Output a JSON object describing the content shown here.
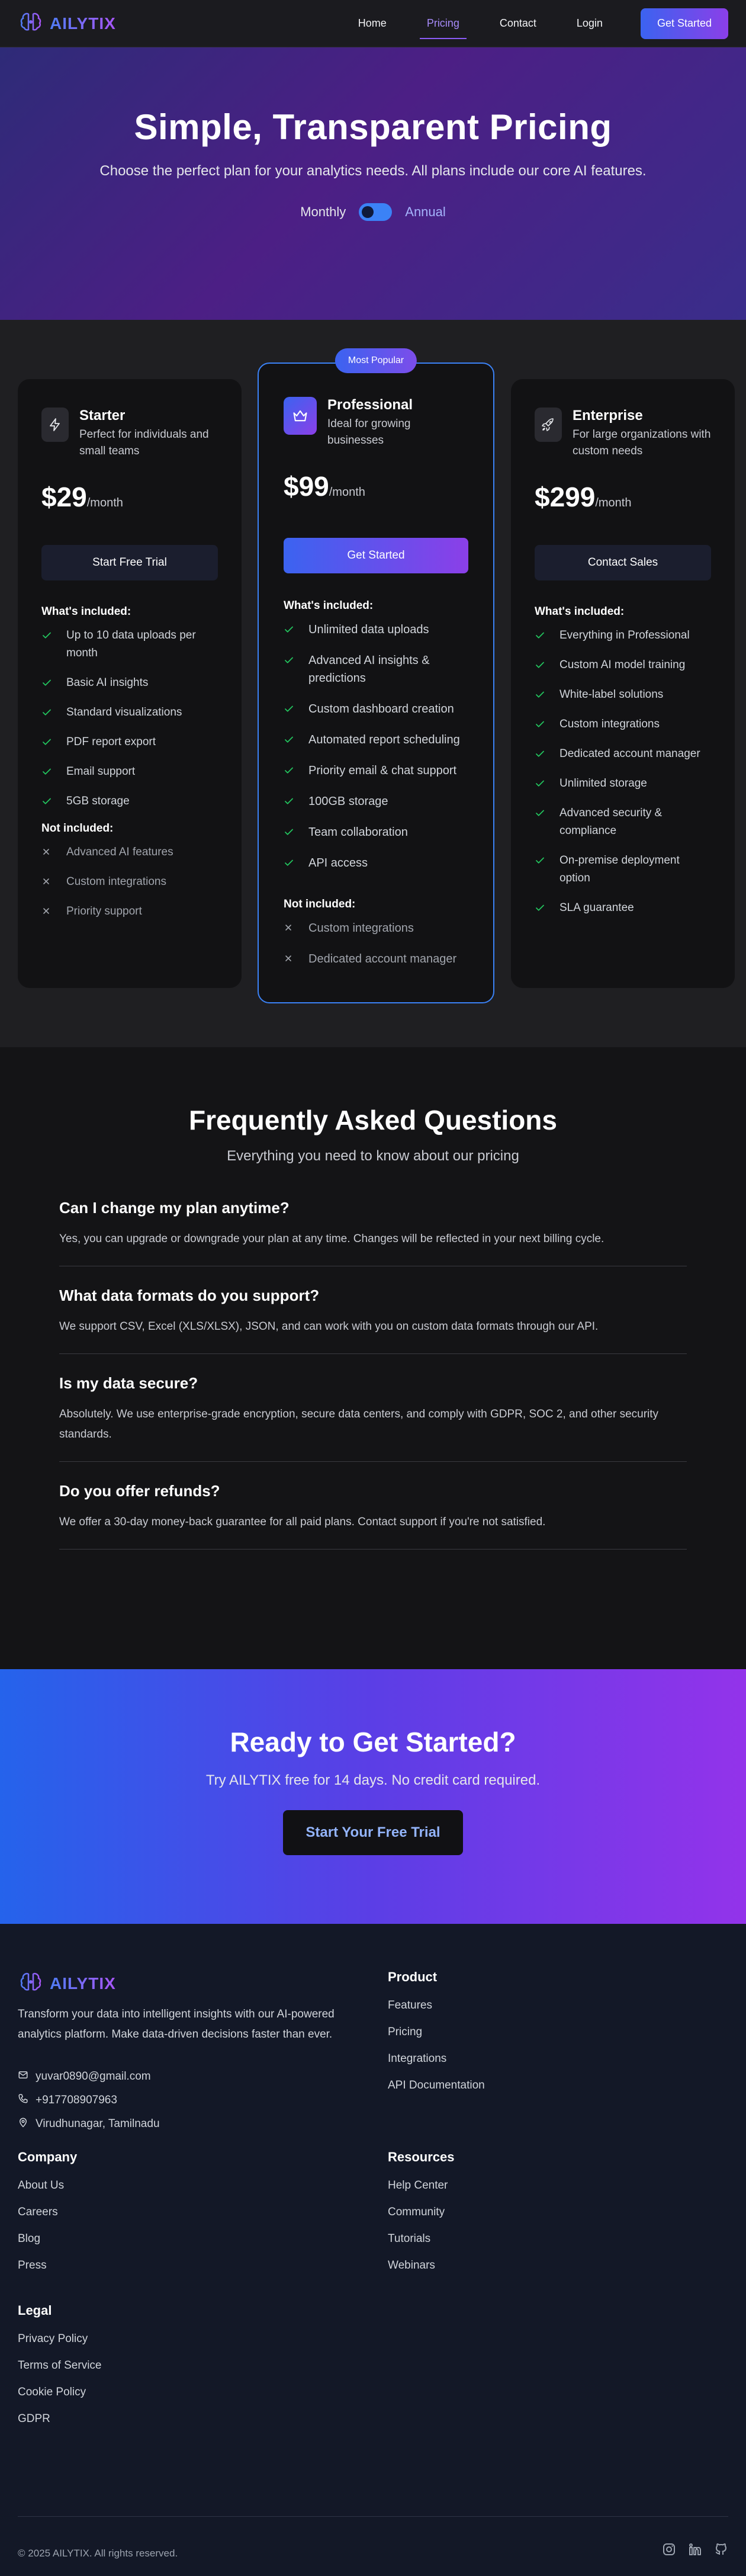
{
  "brand": {
    "name": "AILYTIX"
  },
  "nav": {
    "items": [
      {
        "label": "Home"
      },
      {
        "label": "Pricing"
      },
      {
        "label": "Contact"
      },
      {
        "label": "Login"
      }
    ],
    "active": "Pricing",
    "cta": "Get Started"
  },
  "hero": {
    "title": "Simple, Transparent Pricing",
    "subtitle": "Choose the perfect plan for your analytics needs. All plans include our core AI features.",
    "toggle_monthly": "Monthly",
    "toggle_annual": "Annual"
  },
  "plans": {
    "starter": {
      "name": "Starter",
      "description": "Perfect for individuals and small teams",
      "price": "$29",
      "period": "/month",
      "cta": "Start Free Trial",
      "included_title": "What's included:",
      "included": [
        "Up to 10 data uploads per month",
        "Basic AI insights",
        "Standard visualizations",
        "PDF report export",
        "Email support",
        "5GB storage"
      ],
      "not_included_title": "Not included:",
      "not_included": [
        "Advanced AI features",
        "Custom integrations",
        "Priority support"
      ]
    },
    "professional": {
      "badge": "Most Popular",
      "name": "Professional",
      "description": "Ideal for growing businesses",
      "price": "$99",
      "period": "/month",
      "cta": "Get Started",
      "included_title": "What's included:",
      "included": [
        "Unlimited data uploads",
        "Advanced AI insights & predictions",
        "Custom dashboard creation",
        "Automated report scheduling",
        "Priority email & chat support",
        "100GB storage",
        "Team collaboration",
        "API access"
      ],
      "not_included_title": "Not included:",
      "not_included": [
        "Custom integrations",
        "Dedicated account manager"
      ]
    },
    "enterprise": {
      "name": "Enterprise",
      "description": "For large organizations with custom needs",
      "price": "$299",
      "period": "/month",
      "cta": "Contact Sales",
      "included_title": "What's included:",
      "included": [
        "Everything in Professional",
        "Custom AI model training",
        "White-label solutions",
        "Custom integrations",
        "Dedicated account manager",
        "Unlimited storage",
        "Advanced security & compliance",
        "On-premise deployment option",
        "SLA guarantee"
      ]
    }
  },
  "faq": {
    "title": "Frequently Asked Questions",
    "subtitle": "Everything you need to know about our pricing",
    "items": [
      {
        "q": "Can I change my plan anytime?",
        "a": "Yes, you can upgrade or downgrade your plan at any time. Changes will be reflected in your next billing cycle."
      },
      {
        "q": "What data formats do you support?",
        "a": "We support CSV, Excel (XLS/XLSX), JSON, and can work with you on custom data formats through our API."
      },
      {
        "q": "Is my data secure?",
        "a": "Absolutely. We use enterprise-grade encryption, secure data centers, and comply with GDPR, SOC 2, and other security standards."
      },
      {
        "q": "Do you offer refunds?",
        "a": "We offer a 30-day money-back guarantee for all paid plans. Contact support if you're not satisfied."
      }
    ]
  },
  "ready": {
    "title": "Ready to Get Started?",
    "subtitle": "Try AILYTIX free for 14 days. No credit card required.",
    "cta": "Start Your Free Trial"
  },
  "footer": {
    "tagline": "Transform your data into intelligent insights with our AI-powered analytics platform. Make data-driven decisions faster than ever.",
    "email": "yuvar0890@gmail.com",
    "phone": "+917708907963",
    "location": "Virudhunagar, Tamilnadu",
    "product": {
      "title": "Product",
      "links": [
        "Features",
        "Pricing",
        "Integrations",
        "API Documentation"
      ]
    },
    "company": {
      "title": "Company",
      "links": [
        "About Us",
        "Careers",
        "Blog",
        "Press"
      ]
    },
    "resources": {
      "title": "Resources",
      "links": [
        "Help Center",
        "Community",
        "Tutorials",
        "Webinars"
      ]
    },
    "legal": {
      "title": "Legal",
      "links": [
        "Privacy Policy",
        "Terms of Service",
        "Cookie Policy",
        "GDPR"
      ]
    },
    "copyright": "© 2025 AILYTIX. All rights reserved.",
    "social": [
      "instagram-icon",
      "linkedin-icon",
      "github-icon"
    ]
  },
  "colors": {
    "accent_blue": "#3b63f0",
    "accent_purple": "#8b3fe8",
    "check_green": "#22c55e"
  }
}
